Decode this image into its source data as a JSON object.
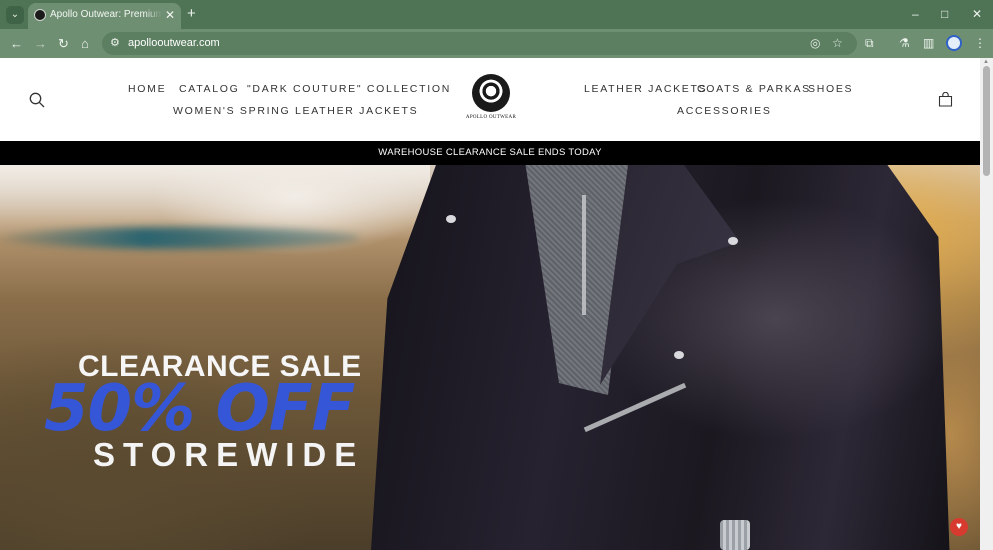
{
  "browser": {
    "tab_title": "Apollo Outwear: Premium Quality",
    "tab_close": "✕",
    "new_tab": "+",
    "tab_search_icon": "chevron-down-icon",
    "url": "apollooutwear.com",
    "window_controls": [
      "–",
      "□",
      "✕"
    ],
    "nav": [
      "←",
      "→",
      "↻",
      "⌂"
    ],
    "colors": {
      "frame": "#4e7355",
      "toolbar": "#6f8f73"
    }
  },
  "header": {
    "nav_left": [
      "HOME",
      "CATALOG",
      "\"DARK COUTURE\" COLLECTION",
      "WOMEN'S SPRING LEATHER JACKETS"
    ],
    "nav_right": [
      "LEATHER JACKETS",
      "COATS & PARKAS",
      "SHOES",
      "ACCESSORIES"
    ],
    "logo_text": "APOLLO OUTWEAR",
    "search_icon": "search-icon",
    "cart_icon": "shopping-bag-icon"
  },
  "announcement": "WAREHOUSE CLEARANCE SALE ENDS TODAY",
  "hero": {
    "line1": "CLEARANCE SALE",
    "line2": "50% OFF",
    "line3": "STOREWIDE",
    "colors": {
      "accent": "#3656d8"
    }
  },
  "widget": {
    "icon": "chat-widget-icon"
  }
}
